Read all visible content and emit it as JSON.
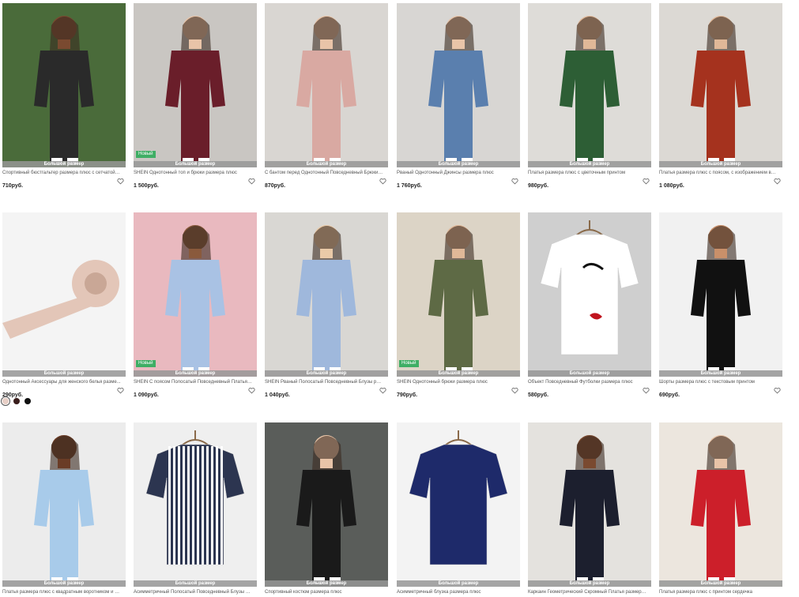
{
  "products": [
    {
      "title": "Спортивный бюстгальтер размера плюс с сетчатой в...",
      "price": "710руб.",
      "badge": "Большой размер",
      "is_new": false,
      "bg": "#4a6b3a",
      "fig": "#2a2a2a",
      "skin": "#7a4a30"
    },
    {
      "title": "SHEIN Однотонный топ и брюки размера плюс",
      "price": "1 500руб.",
      "badge": "Большой размер",
      "is_new": true,
      "new_label": "Новый",
      "bg": "#c9c6c2",
      "fig": "#6a1e2a",
      "skin": "#e8c4a8"
    },
    {
      "title": "С бантом перед Однотонный Повседневный Брюки р...",
      "price": "870руб.",
      "badge": "Большой размер",
      "is_new": false,
      "bg": "#d9d6d2",
      "fig": "#d9a9a2",
      "skin": "#e8c4a8"
    },
    {
      "title": "Рваный Однотонный Джинсы размера плюс",
      "price": "1 760руб.",
      "badge": "Большой размер",
      "is_new": false,
      "bg": "#d8d6d3",
      "fig": "#5a7fae",
      "skin": "#e8c4a8"
    },
    {
      "title": "Платья размера плюс с цветочным принтом",
      "price": "980руб.",
      "badge": "Большой размер",
      "is_new": false,
      "bg": "#dedcd8",
      "fig": "#2d5e35",
      "skin": "#e0b898"
    },
    {
      "title": "Платья размера плюс с поясом, с изображением вороткен...",
      "price": "1 080руб.",
      "badge": "Большой размер",
      "is_new": false,
      "bg": "#dcd9d4",
      "fig": "#a5321e",
      "skin": "#e0b898"
    },
    {
      "title": "Однотонный Аксессуары для женского белья разме...",
      "price": "290руб.",
      "badge": "Большой размер",
      "is_new": false,
      "bg": "#f4f4f4",
      "fig": "#e3c6b8",
      "skin": "#e3c6b8",
      "swatches": [
        "#e8cfc6",
        "#3a1e1c",
        "#111111"
      ]
    },
    {
      "title": "SHEIN С поясом Полосатый Повседневный Платья р...",
      "price": "1 090руб.",
      "badge": "Большой размер",
      "is_new": true,
      "new_label": "Новый",
      "bg": "#e9b9bf",
      "fig": "#a9c2e4",
      "skin": "#8a5a3c"
    },
    {
      "title": "SHEIN Рваный Полосатый Повседневный Блузы раз...",
      "price": "1 040руб.",
      "badge": "Большой размер",
      "is_new": false,
      "bg": "#d9d7d3",
      "fig": "#9fb8dc",
      "skin": "#eacaa8"
    },
    {
      "title": "SHEIN Однотонный брюки размера плюс",
      "price": "790руб.",
      "badge": "Большой размер",
      "is_new": true,
      "new_label": "Новый",
      "bg": "#dcd4c6",
      "fig": "#5e6a45",
      "skin": "#e0b898"
    },
    {
      "title": "Объект Повседневный Футболки размера плюс",
      "price": "580руб.",
      "badge": "Большой размер",
      "is_new": false,
      "bg": "#cfcfcf",
      "fig": "#ffffff",
      "skin": "#ffffff"
    },
    {
      "title": "Шорты размера плюс с текстовым принтом",
      "price": "690руб.",
      "badge": "Большой размер",
      "is_new": false,
      "bg": "#f1f1f1",
      "fig": "#111111",
      "skin": "#c9906a"
    },
    {
      "title": "Платья размера плюс с квадратным воротником и це...",
      "price": "",
      "badge": "Большой размер",
      "is_new": false,
      "bg": "#ececec",
      "fig": "#a8cbea",
      "skin": "#6a3c26"
    },
    {
      "title": "Асимметричный Полосатый Повседневный Блузы ра...",
      "price": "",
      "badge": "Большой размер",
      "is_new": false,
      "bg": "#efefef",
      "fig": "#2c3550",
      "skin": "#2c3550"
    },
    {
      "title": "Спортивный костюм размера плюс",
      "price": "",
      "badge": "Большой размер",
      "is_new": false,
      "bg": "#5a5d5a",
      "fig": "#1a1a1a",
      "skin": "#e8c4a8"
    },
    {
      "title": "Асимметричный блузка размера плюс",
      "price": "",
      "badge": "Большой размер",
      "is_new": false,
      "bg": "#f3f3f3",
      "fig": "#1e2a6a",
      "skin": "#1e2a6a"
    },
    {
      "title": "Каркаин Геометрический Скромный Платья размера пл...",
      "price": "",
      "badge": "Большой размер",
      "is_new": false,
      "bg": "#e4e2de",
      "fig": "#1c1f2e",
      "skin": "#7a4a30"
    },
    {
      "title": "Платья размера плюс с принтом сердечка",
      "price": "",
      "badge": "Большой размер",
      "is_new": false,
      "bg": "#ece6de",
      "fig": "#cc1f2a",
      "skin": "#e8c4a8"
    }
  ]
}
